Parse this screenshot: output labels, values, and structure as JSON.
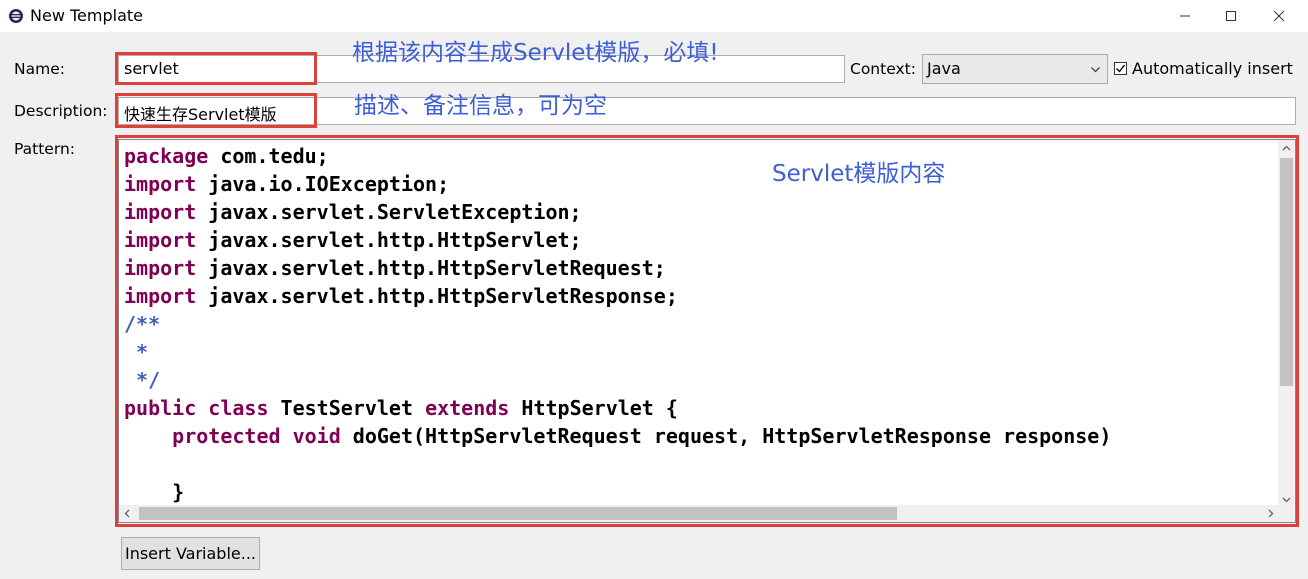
{
  "window": {
    "title": "New Template",
    "controls": [
      "minimize",
      "maximize",
      "close"
    ]
  },
  "form": {
    "name_label": "Name:",
    "name_value": "servlet",
    "context_label": "Context:",
    "context_value": "Java",
    "auto_insert_label": "Automatically insert",
    "auto_insert_checked": true,
    "description_label": "Description:",
    "description_value": "快速生存Servlet模版",
    "pattern_label": "Pattern:"
  },
  "pattern_lines": [
    [
      [
        "kw",
        "package"
      ],
      [
        "txt",
        " com.tedu;"
      ]
    ],
    [
      [
        "kw",
        "import"
      ],
      [
        "txt",
        " java.io.IOException;"
      ]
    ],
    [
      [
        "kw",
        "import"
      ],
      [
        "txt",
        " javax.servlet.ServletException;"
      ]
    ],
    [
      [
        "kw",
        "import"
      ],
      [
        "txt",
        " javax.servlet.http.HttpServlet;"
      ]
    ],
    [
      [
        "kw",
        "import"
      ],
      [
        "txt",
        " javax.servlet.http.HttpServletRequest;"
      ]
    ],
    [
      [
        "kw",
        "import"
      ],
      [
        "txt",
        " javax.servlet.http.HttpServletResponse;"
      ]
    ],
    [
      [
        "jd",
        "/**"
      ]
    ],
    [
      [
        "jd",
        " *"
      ]
    ],
    [
      [
        "jd",
        " */"
      ]
    ],
    [
      [
        "kw",
        "public"
      ],
      [
        "txt",
        " "
      ],
      [
        "kw",
        "class"
      ],
      [
        "txt",
        " TestServlet "
      ],
      [
        "kw",
        "extends"
      ],
      [
        "txt",
        " HttpServlet {"
      ]
    ],
    [
      [
        "txt",
        "    "
      ],
      [
        "kw",
        "protected"
      ],
      [
        "txt",
        " "
      ],
      [
        "kw",
        "void"
      ],
      [
        "txt",
        " doGet(HttpServletRequest request, HttpServletResponse response)"
      ]
    ],
    [
      [
        "txt",
        ""
      ]
    ],
    [
      [
        "txt",
        "    }"
      ]
    ]
  ],
  "buttons": {
    "insert_variable": "Insert Variable..."
  },
  "annotations": {
    "name_note": "根据该内容生成Servlet模版，必填!",
    "description_note": "描述、备注信息，可为空",
    "pattern_note": "Servlet模版内容"
  },
  "colors": {
    "keyword": "#7f0055",
    "javadoc": "#3f5fbf",
    "annotation_box": "#e0403c",
    "annotation_text": "#3d5ed8"
  }
}
